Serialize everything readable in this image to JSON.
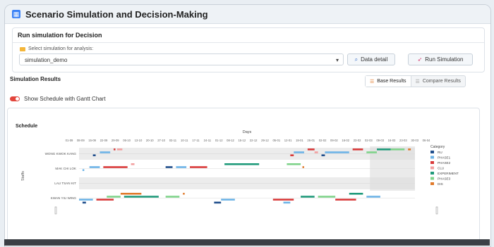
{
  "app": {
    "title": "Scenario Simulation and Decision-Making",
    "icon": "dashboard-icon"
  },
  "run_panel": {
    "header": "Run simulation for Decision",
    "select_label": "Select simulation for analysis:",
    "selected_value": "simulation_demo",
    "data_detail_label": "Data detail",
    "run_label": "Run Simulation"
  },
  "results": {
    "title": "Simulation Results",
    "tabs": [
      {
        "label": "Base Results",
        "active": true
      },
      {
        "label": "Compare Results",
        "active": false
      }
    ],
    "toggle_label": "Show Schedule with Gantt Chart",
    "toggle_on": true,
    "toggle_color": "#e2453c"
  },
  "chart_data": {
    "type": "gantt",
    "title": "Schedule",
    "xlabel": "Days",
    "ylabel": "Staffs",
    "x_ticks": [
      "01-09",
      "08-09",
      "15-09",
      "22-09",
      "29-09",
      "06-10",
      "13-10",
      "20-10",
      "27-10",
      "03-11",
      "10-11",
      "17-11",
      "24-11",
      "01-12",
      "08-12",
      "15-12",
      "22-12",
      "29-12",
      "05-01",
      "12-01",
      "19-01",
      "26-01",
      "02-02",
      "09-02",
      "16-02",
      "23-02",
      "02-03",
      "09-03",
      "16-03",
      "23-03",
      "30-03",
      "06-04"
    ],
    "staffs": [
      "WONG KWOK KANG",
      "MAK CHI LOK",
      "LAU TSAN KIT",
      "KWAN YIU WING"
    ],
    "categories": [
      {
        "name": "RU",
        "color": "#1f4e8c"
      },
      {
        "name": "PHASE1",
        "color": "#6db3e6"
      },
      {
        "name": "PHASE2",
        "color": "#d93a3a"
      },
      {
        "name": "CLU",
        "color": "#f2a0a0"
      },
      {
        "name": "EXPERIMENT",
        "color": "#1f9a7a"
      },
      {
        "name": "PHASE3",
        "color": "#7fd38a"
      },
      {
        "name": "DIS",
        "color": "#e07a2b"
      }
    ],
    "legend_title": "Category",
    "legend_position": "right",
    "bands": [
      {
        "staff": "WONG KWOK KANG",
        "tasks": [
          {
            "cat": "RU",
            "start": 4,
            "end": 4.8,
            "lane": 2
          },
          {
            "cat": "PHASE1",
            "start": 6,
            "end": 9,
            "lane": 1
          },
          {
            "cat": "PHASE2",
            "start": 10,
            "end": 10.5,
            "lane": 0
          },
          {
            "cat": "CLU",
            "start": 11,
            "end": 12.5,
            "lane": 0
          },
          {
            "cat": "PHASE2",
            "start": 61,
            "end": 62,
            "lane": 2
          },
          {
            "cat": "PHASE1",
            "start": 62,
            "end": 65,
            "lane": 1
          },
          {
            "cat": "PHASE2",
            "start": 66,
            "end": 68,
            "lane": 0
          },
          {
            "cat": "CLU",
            "start": 68,
            "end": 69,
            "lane": 1
          },
          {
            "cat": "RU",
            "start": 70,
            "end": 71,
            "lane": 2
          },
          {
            "cat": "PHASE1",
            "start": 71,
            "end": 78,
            "lane": 1
          },
          {
            "cat": "PHASE2",
            "start": 79,
            "end": 82,
            "lane": 0
          },
          {
            "cat": "PHASE3",
            "start": 83,
            "end": 86,
            "lane": 1
          },
          {
            "cat": "EXPERIMENT",
            "start": 86,
            "end": 90,
            "lane": 0
          },
          {
            "cat": "PHASE3",
            "start": 90,
            "end": 94,
            "lane": 0
          },
          {
            "cat": "DIS",
            "start": 95,
            "end": 95.8,
            "lane": 0
          }
        ]
      },
      {
        "staff": "MAK CHI LOK",
        "tasks": [
          {
            "cat": "PHASE1",
            "start": 1,
            "end": 1.5,
            "lane": 2
          },
          {
            "cat": "PHASE1",
            "start": 3,
            "end": 6,
            "lane": 1
          },
          {
            "cat": "PHASE2",
            "start": 7,
            "end": 14,
            "lane": 1
          },
          {
            "cat": "CLU",
            "start": 15,
            "end": 16,
            "lane": 0
          },
          {
            "cat": "RU",
            "start": 25,
            "end": 27,
            "lane": 1
          },
          {
            "cat": "PHASE1",
            "start": 28,
            "end": 31,
            "lane": 1
          },
          {
            "cat": "PHASE2",
            "start": 32,
            "end": 37,
            "lane": 1
          },
          {
            "cat": "EXPERIMENT",
            "start": 42,
            "end": 52,
            "lane": 0
          },
          {
            "cat": "PHASE3",
            "start": 60,
            "end": 64,
            "lane": 0
          },
          {
            "cat": "DIS",
            "start": 64.5,
            "end": 65,
            "lane": 1
          }
        ]
      },
      {
        "staff": "LAU TSAN KIT",
        "tasks": []
      },
      {
        "staff": "KWAN YIU WING",
        "tasks": [
          {
            "cat": "PHASE1",
            "start": 0,
            "end": 4,
            "lane": 2
          },
          {
            "cat": "RU",
            "start": 1,
            "end": 2,
            "lane": 3
          },
          {
            "cat": "PHASE2",
            "start": 5,
            "end": 10,
            "lane": 2
          },
          {
            "cat": "PHASE3",
            "start": 8,
            "end": 12,
            "lane": 1
          },
          {
            "cat": "DIS",
            "start": 12,
            "end": 18,
            "lane": 0
          },
          {
            "cat": "EXPERIMENT",
            "start": 13,
            "end": 23,
            "lane": 1
          },
          {
            "cat": "PHASE3",
            "start": 25,
            "end": 29,
            "lane": 1
          },
          {
            "cat": "DIS",
            "start": 30,
            "end": 30.5,
            "lane": 0
          },
          {
            "cat": "RU",
            "start": 39,
            "end": 41,
            "lane": 3
          },
          {
            "cat": "PHASE1",
            "start": 41,
            "end": 45,
            "lane": 2
          },
          {
            "cat": "PHASE2",
            "start": 56,
            "end": 62,
            "lane": 2
          },
          {
            "cat": "PHASE1",
            "start": 59,
            "end": 61,
            "lane": 3
          },
          {
            "cat": "EXPERIMENT",
            "start": 64,
            "end": 68,
            "lane": 1
          },
          {
            "cat": "PHASE3",
            "start": 69,
            "end": 74,
            "lane": 1
          },
          {
            "cat": "PHASE2",
            "start": 74,
            "end": 80,
            "lane": 2
          },
          {
            "cat": "EXPERIMENT",
            "start": 78,
            "end": 82,
            "lane": 0
          },
          {
            "cat": "PHASE1",
            "start": 83,
            "end": 87,
            "lane": 1
          }
        ]
      }
    ],
    "x_range": [
      0,
      97
    ]
  }
}
